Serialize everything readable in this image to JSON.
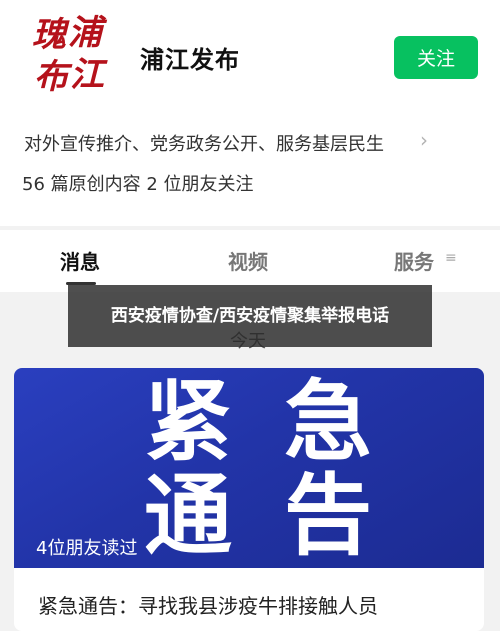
{
  "account": {
    "name": "浦江发布",
    "logo_chars": [
      "瑰",
      "浦",
      "布",
      "江"
    ],
    "follow_label": "关注",
    "description": "对外宣传推介、党务政务公开、服务基层民生",
    "stats": "56 篇原创内容  2 位朋友关注"
  },
  "tabs": [
    {
      "label": "消息"
    },
    {
      "label": "视频"
    },
    {
      "label": "服务"
    }
  ],
  "overlay_caption": "西安疫情协查/西安疫情聚集举报电话",
  "date_label": "今天",
  "article": {
    "banner_chars": [
      "紧",
      "急",
      "通",
      "告"
    ],
    "read_count": "4位朋友读过",
    "title": "紧急通告：寻找我县涉疫牛排接触人员"
  },
  "colors": {
    "follow_green": "#07c160",
    "banner_blue": "#2234a8",
    "logo_red": "#b5121b"
  }
}
